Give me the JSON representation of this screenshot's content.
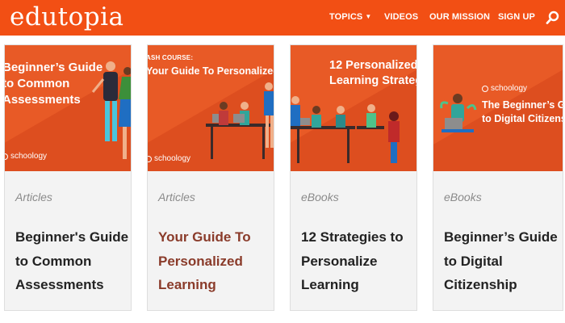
{
  "header": {
    "logo": "edutopia",
    "nav": [
      {
        "label": "TOPICS",
        "has_dropdown": true
      },
      {
        "label": "VIDEOS"
      },
      {
        "label": "OUR MISSION"
      },
      {
        "label": "SIGN UP"
      }
    ],
    "search_icon": "search-icon",
    "brand_color": "#f24f14"
  },
  "cards": [
    {
      "type": "Articles",
      "title": "Beginner's Guide to Common Assessments",
      "image_text": [
        "Beginner’s Guide",
        "to Common",
        "Assessments"
      ],
      "image_brand": "schoology"
    },
    {
      "type": "Articles",
      "title": "Your Guide To Personalized Learning",
      "image_kicker": "ASH COURSE:",
      "image_text": [
        "Your Guide To Personalized Learning"
      ],
      "image_brand": "schoology",
      "title_color": "#8a3b2a"
    },
    {
      "type": "eBooks",
      "title": "12 Strategies to Personalize Learning",
      "image_text": [
        "12 Personalized",
        "Learning Strategies"
      ]
    },
    {
      "type": "eBooks",
      "title": "Beginner’s Guide to Digital Citizenship",
      "image_brand": "schoology",
      "image_text": [
        "The Beginner’s Guide",
        "to Digital Citizenship"
      ]
    }
  ]
}
